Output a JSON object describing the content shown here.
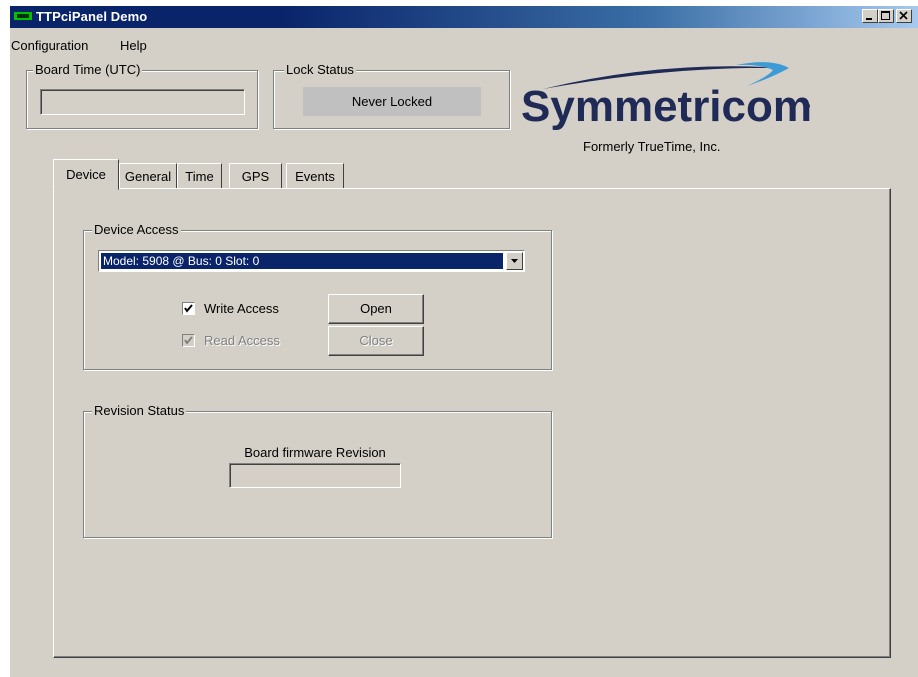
{
  "window": {
    "title": "TTPciPanel Demo"
  },
  "menu": [
    {
      "label": "Configuration"
    },
    {
      "label": "Help"
    }
  ],
  "board_time": {
    "label": "Board Time (UTC)",
    "value": ""
  },
  "lock_status": {
    "label": "Lock Status",
    "value": "Never Locked"
  },
  "logo": {
    "brand": "Symmetricom",
    "tagline": "Formerly TrueTime, Inc."
  },
  "tabs": [
    {
      "label": "Device",
      "active": true
    },
    {
      "label": "General",
      "active": false
    },
    {
      "label": "Time",
      "active": false
    },
    {
      "label": "GPS",
      "active": false
    },
    {
      "label": "Events",
      "active": false
    }
  ],
  "device_access": {
    "label": "Device Access",
    "selected_device": "Model: 5908 @ Bus: 0 Slot: 0",
    "write_access": {
      "label": "Write Access",
      "checked": true,
      "enabled": true
    },
    "read_access": {
      "label": "Read Access",
      "checked": true,
      "enabled": false
    },
    "open_label": "Open",
    "close_label": "Close"
  },
  "revision_status": {
    "label": "Revision Status",
    "firmware_label": "Board firmware Revision",
    "firmware_value": ""
  },
  "colors": {
    "title_bar": "#0a246a",
    "window_face": "#d4d0c8",
    "selection": "#0a246a",
    "logo_text": "#1f2b56",
    "logo_swoosh": "#3c9bd6"
  }
}
